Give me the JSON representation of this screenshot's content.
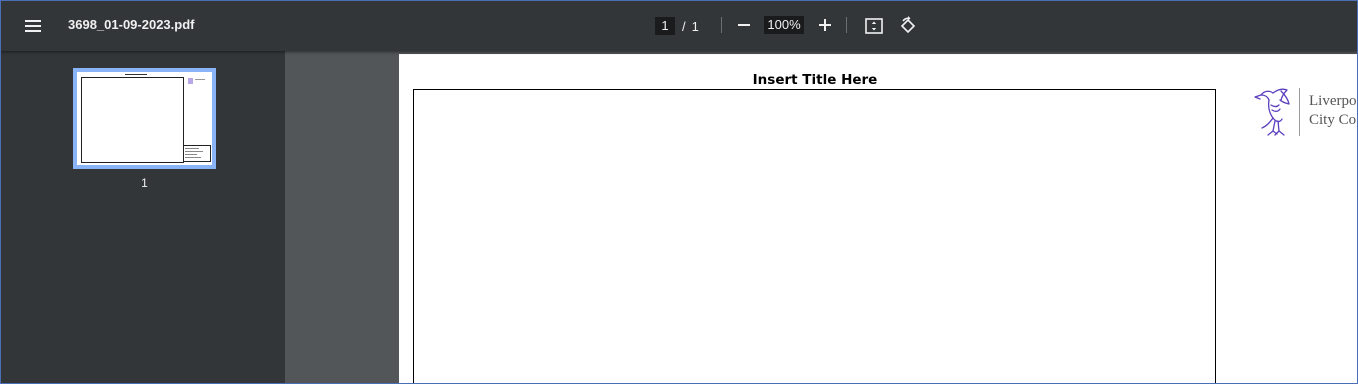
{
  "toolbar": {
    "file_name": "3698_01-09-2023.pdf",
    "current_page": "1",
    "page_separator": "/",
    "total_pages": "1",
    "zoom": "100%",
    "icons": [
      "menu-icon",
      "zoom-out-icon",
      "zoom-in-icon",
      "fit-to-page-icon",
      "rotate-icon"
    ]
  },
  "sidebar": {
    "thumbnails": [
      {
        "page_number": "1",
        "selected": true
      }
    ]
  },
  "document": {
    "title": "Insert Title Here",
    "logo": {
      "icon": "liver-bird-icon",
      "line1": "Liverpo",
      "line2": "City Co"
    }
  },
  "colors": {
    "toolbar_bg": "#323639",
    "viewer_bg": "#525659",
    "thumbnail_selection": "#8ab4f8",
    "logo_purple": "#5b3fbf"
  }
}
